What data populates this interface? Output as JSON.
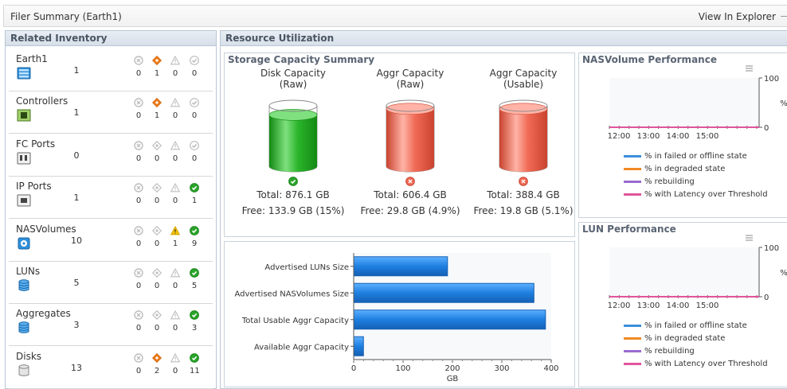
{
  "header": {
    "title": "Filer Summary (Earth1)",
    "link": "View In Explorer"
  },
  "inventory": {
    "title": "Related Inventory",
    "rows": [
      {
        "name": "Earth1",
        "count": "1",
        "icon": "server-icon",
        "states": [
          "0",
          "1",
          "0",
          "0"
        ],
        "active": [
          false,
          true,
          false,
          false
        ]
      },
      {
        "name": "Controllers",
        "count": "1",
        "icon": "controller-icon",
        "states": [
          "0",
          "1",
          "0",
          "0"
        ],
        "active": [
          false,
          true,
          false,
          false
        ]
      },
      {
        "name": "FC Ports",
        "count": "0",
        "icon": "fc-port-icon",
        "states": [
          "0",
          "0",
          "0",
          "0"
        ],
        "active": [
          false,
          false,
          false,
          false
        ]
      },
      {
        "name": "IP Ports",
        "count": "1",
        "icon": "ip-port-icon",
        "states": [
          "0",
          "0",
          "0",
          "1"
        ],
        "active": [
          false,
          false,
          false,
          true
        ]
      },
      {
        "name": "NASVolumes",
        "count": "10",
        "icon": "nas-volume-icon",
        "states": [
          "0",
          "0",
          "1",
          "9"
        ],
        "active": [
          false,
          false,
          true,
          true
        ]
      },
      {
        "name": "LUNs",
        "count": "5",
        "icon": "lun-icon",
        "states": [
          "0",
          "0",
          "0",
          "5"
        ],
        "active": [
          false,
          false,
          false,
          true
        ]
      },
      {
        "name": "Aggregates",
        "count": "3",
        "icon": "aggregate-icon",
        "states": [
          "0",
          "0",
          "0",
          "3"
        ],
        "active": [
          false,
          false,
          false,
          true
        ]
      },
      {
        "name": "Disks",
        "count": "13",
        "icon": "disk-icon",
        "states": [
          "0",
          "2",
          "0",
          "11"
        ],
        "active": [
          false,
          true,
          false,
          true
        ]
      }
    ]
  },
  "resource": {
    "title": "Resource Utilization",
    "storage": {
      "title": "Storage Capacity Summary",
      "cylinders": [
        {
          "title1": "Disk Capacity",
          "title2": "(Raw)",
          "total": "Total: 876.1 GB",
          "free": "Free: 133.9 GB (15%)",
          "status": "ok",
          "fill": 0.85,
          "color": "#2bb52b"
        },
        {
          "title1": "Aggr Capacity",
          "title2": "(Raw)",
          "total": "Total: 606.4 GB",
          "free": "Free: 29.8 GB (4.9%)",
          "status": "critical",
          "fill": 0.95,
          "color": "#f06a55"
        },
        {
          "title1": "Aggr Capacity",
          "title2": "(Usable)",
          "total": "Total: 388.4 GB",
          "free": "Free: 19.8 GB (5.1%)",
          "status": "critical",
          "fill": 0.95,
          "color": "#f06a55"
        }
      ]
    },
    "nas_perf": {
      "title": "NASVolume Performance"
    },
    "lun_perf": {
      "title": "LUN Performance"
    },
    "perf_legend": [
      {
        "label": "% in failed or offline state",
        "color": "#3b8fdc"
      },
      {
        "label": "% in degraded state",
        "color": "#f08a24"
      },
      {
        "label": "% rebuilding",
        "color": "#9a6bd0"
      },
      {
        "label": "% with Latency over Threshold",
        "color": "#e0559a"
      }
    ]
  },
  "chart_data": [
    {
      "type": "bar",
      "orientation": "horizontal",
      "categories": [
        "Advertised LUNs Size",
        "Advertised NASVolumes Size",
        "Total Usable Aggr Capacity",
        "Available Aggr Capacity"
      ],
      "values": [
        190,
        365,
        388.4,
        19.8
      ],
      "xlabel": "GB",
      "xlim": [
        0,
        400
      ],
      "xticks": [
        0,
        100,
        200,
        300,
        400
      ],
      "color": "#1e7fe0"
    },
    {
      "type": "line",
      "title": "NASVolume Performance",
      "x": [
        "12:00",
        "13:00",
        "14:00",
        "15:00"
      ],
      "ylabel": "%",
      "ylim": [
        0,
        100
      ],
      "yticks": [
        0,
        100
      ],
      "series": [
        {
          "name": "% in failed or offline state",
          "values": [
            0,
            0,
            0,
            0
          ]
        },
        {
          "name": "% in degraded state",
          "values": [
            0,
            0,
            0,
            0
          ]
        },
        {
          "name": "% rebuilding",
          "values": [
            0,
            0,
            0,
            0
          ]
        },
        {
          "name": "% with Latency over Threshold",
          "values": [
            0,
            0,
            0,
            0
          ]
        }
      ]
    },
    {
      "type": "line",
      "title": "LUN Performance",
      "x": [
        "12:00",
        "13:00",
        "14:00",
        "15:00"
      ],
      "ylabel": "%",
      "ylim": [
        0,
        100
      ],
      "yticks": [
        0,
        100
      ],
      "series": [
        {
          "name": "% in failed or offline state",
          "values": [
            0,
            0,
            0,
            0
          ]
        },
        {
          "name": "% in degraded state",
          "values": [
            0,
            0,
            0,
            0
          ]
        },
        {
          "name": "% rebuilding",
          "values": [
            0,
            0,
            0,
            0
          ]
        },
        {
          "name": "% with Latency over Threshold",
          "values": [
            0,
            0,
            0,
            0
          ]
        }
      ]
    }
  ]
}
